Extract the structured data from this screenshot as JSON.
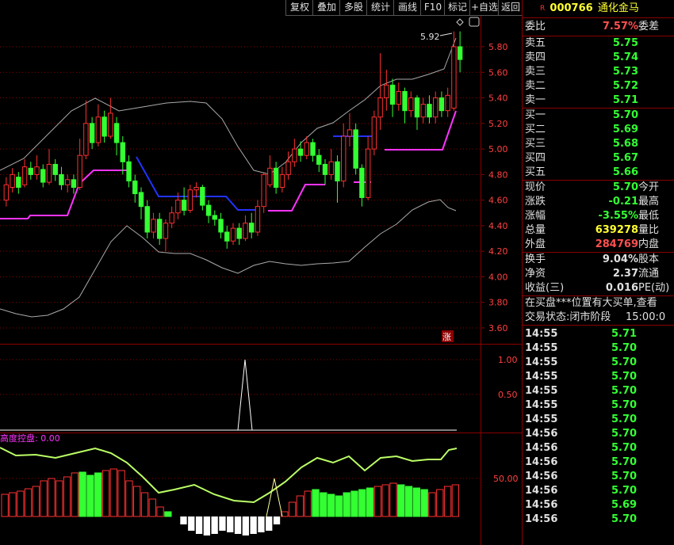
{
  "toolbar": {
    "buttons": [
      "复权",
      "叠加",
      "多股",
      "统计",
      "画线",
      "F10",
      "标记",
      "+自选",
      "返回"
    ]
  },
  "stock": {
    "flag": "R",
    "code": "000766",
    "name": "通化金马"
  },
  "ratio": {
    "label": "委比",
    "value": "7.57%",
    "label2": "委差"
  },
  "asks": [
    {
      "label": "卖五",
      "price": "5.75"
    },
    {
      "label": "卖四",
      "price": "5.74"
    },
    {
      "label": "卖三",
      "price": "5.73"
    },
    {
      "label": "卖二",
      "price": "5.72"
    },
    {
      "label": "卖一",
      "price": "5.71"
    }
  ],
  "bids": [
    {
      "label": "买一",
      "price": "5.70"
    },
    {
      "label": "买二",
      "price": "5.69"
    },
    {
      "label": "买三",
      "price": "5.68"
    },
    {
      "label": "买四",
      "price": "5.67"
    },
    {
      "label": "买五",
      "price": "5.66"
    }
  ],
  "stats1": [
    {
      "label": "现价",
      "value": "5.70",
      "label2": "今开",
      "color": "green"
    },
    {
      "label": "涨跌",
      "value": "-0.21",
      "label2": "最高",
      "color": "green"
    },
    {
      "label": "涨幅",
      "value": "-3.55%",
      "label2": "最低",
      "color": "green"
    },
    {
      "label": "总量",
      "value": "639278",
      "label2": "量比",
      "color": "yellow"
    },
    {
      "label": "外盘",
      "value": "284769",
      "label2": "内盘",
      "color": "red"
    }
  ],
  "stats2": [
    {
      "label": "换手",
      "value": "9.04%",
      "label2": "股本"
    },
    {
      "label": "净资",
      "value": "2.37",
      "label2": "流通"
    },
    {
      "label": "收益(三)",
      "value": "0.016",
      "label2": "PE(动)"
    }
  ],
  "notice": "在买盘***位置有大买单,查看",
  "status": {
    "label": "交易状态:",
    "value": "闭市阶段",
    "time": "15:00:0"
  },
  "ticks": [
    {
      "time": "14:55",
      "price": "5.71"
    },
    {
      "time": "14:55",
      "price": "5.70"
    },
    {
      "time": "14:55",
      "price": "5.70"
    },
    {
      "time": "14:55",
      "price": "5.70"
    },
    {
      "time": "14:55",
      "price": "5.70"
    },
    {
      "time": "14:55",
      "price": "5.70"
    },
    {
      "time": "14:55",
      "price": "5.70"
    },
    {
      "time": "14:56",
      "price": "5.70"
    },
    {
      "time": "14:56",
      "price": "5.70"
    },
    {
      "time": "14:56",
      "price": "5.70"
    },
    {
      "time": "14:56",
      "price": "5.70"
    },
    {
      "time": "14:56",
      "price": "5.70"
    },
    {
      "time": "14:56",
      "price": "5.69"
    },
    {
      "time": "14:56",
      "price": "5.70"
    }
  ],
  "price_axis": [
    "5.80",
    "5.60",
    "5.40",
    "5.20",
    "5.00",
    "4.80",
    "4.60",
    "4.40",
    "4.20",
    "4.00",
    "3.80",
    "3.60"
  ],
  "indicator_axis": [
    "1.00",
    "0.50"
  ],
  "control_axis": "50.00",
  "control_label": "高度控盘: 0.00",
  "high_marker": "5.92",
  "zhang_badge": "涨",
  "colors": {
    "up": "#ff3030",
    "down": "#33ff33",
    "magenta": "#ff33ff",
    "blue": "#2233ff",
    "grid": "#8b0000"
  }
}
